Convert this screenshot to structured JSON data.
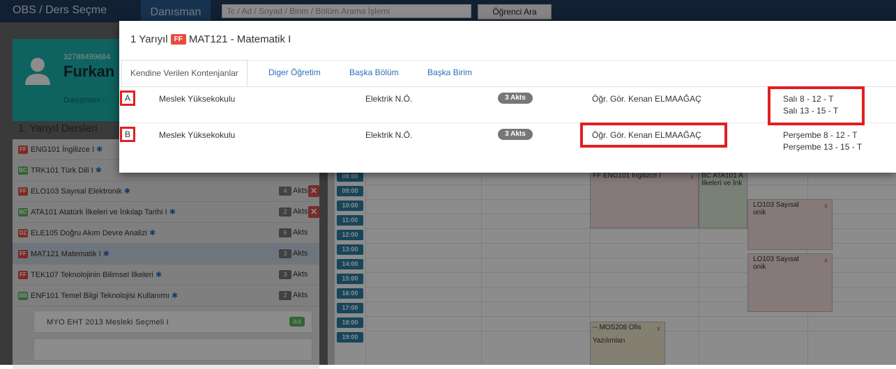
{
  "topbar": {
    "brand": "OBS / Ders Seçme",
    "danisman_tab": "Danısman",
    "search_placeholder": "Tc / Ad / Soyad / Birim / Bölüm  Arama İşlemi",
    "search_button": "Öğrenci Ara"
  },
  "profile": {
    "student_no": "32788499684",
    "name": "Furkan",
    "advisor_label": "Danışmanı :"
  },
  "courses": {
    "title": "1. Yarıyıl Dersleri",
    "items": [
      {
        "tag": "FF",
        "tag_color": "#e74c3c",
        "name": "ENG101 İngilizce I",
        "akts": "",
        "suffix": "",
        "deletable": false
      },
      {
        "tag": "BC",
        "tag_color": "#5cb85c",
        "name": "TRK101 Türk Dili I",
        "akts": "",
        "suffix": "Akts",
        "deletable": false
      },
      {
        "tag": "FF",
        "tag_color": "#e74c3c",
        "name": "ELO103 Sayısal Elektronik",
        "akts": "4",
        "suffix": "Akts",
        "deletable": true
      },
      {
        "tag": "BC",
        "tag_color": "#5cb85c",
        "name": "ATA101 Atatürk İlkeleri ve İnkılap Tarihi I",
        "akts": "2",
        "suffix": "Akts",
        "deletable": true
      },
      {
        "tag": "DZ",
        "tag_color": "#e74c3c",
        "name": "ELE105 Doğru Akım Devre Analizi",
        "akts": "6",
        "suffix": "Akts",
        "deletable": false
      },
      {
        "tag": "FF",
        "tag_color": "#e74c3c",
        "name": "MAT121 Matematik I",
        "akts": "3",
        "suffix": "Akts",
        "deletable": false
      },
      {
        "tag": "FF",
        "tag_color": "#e74c3c",
        "name": "TEK107 Teknolojinin Bilimsel İlkeleri",
        "akts": "3",
        "suffix": "Akts",
        "deletable": false
      },
      {
        "tag": "BB",
        "tag_color": "#5cb85c",
        "name": "ENF101 Temel Bilgi Teknolojisi Kullanımı",
        "akts": "2",
        "suffix": "Akts",
        "deletable": false
      }
    ],
    "electives": [
      {
        "name": "MYO EHT 2013 Mesleki Seçmeli I",
        "count": "4/4"
      }
    ]
  },
  "calendar": {
    "hours": [
      "08:00",
      "09:00",
      "10:00",
      "11:00",
      "12:00",
      "13:00",
      "14:00",
      "15:00",
      "16:00",
      "17:00",
      "18:00",
      "19:00"
    ],
    "events": {
      "eng": "FF ENG101 İngilizce I",
      "ata": "BC ATA101 A",
      "ata2": "İlkeleri ve İnk",
      "elo1a": "LO103 Sayısal",
      "elo1b": "onik",
      "elo2a": "LO103 Sayısal",
      "elo2b": "onik",
      "mosa": "-- MOS208 Ofis",
      "mosb": "Yazılımları",
      "close": "x"
    }
  },
  "modal": {
    "semester": "1 Yarıyıl",
    "badge": "FF",
    "course": "MAT121 - Matematik I",
    "tabs": [
      "Kendine Verilen Kontenjanlar",
      "Diger Öğretim",
      "Başka Bölüm",
      "Başka Birim"
    ],
    "rows": [
      {
        "section": "A",
        "school": "Meslek Yüksekokulu",
        "program": "Elektrik N.Ö.",
        "akts": "3 Akts",
        "teacher": "Öğr. Gör. Kenan ELMAAĞAÇ",
        "times": [
          "Salı 8 - 12 - T",
          "Salı 13 - 15 - T"
        ]
      },
      {
        "section": "B",
        "school": "Meslek Yüksekokulu",
        "program": "Elektrik N.Ö.",
        "akts": "3 Akts",
        "teacher": "Öğr. Gör. Kenan ELMAAĞAÇ",
        "times": [
          "Perşembe 8 - 12 - T",
          "Perşembe 13 - 15 - T"
        ]
      }
    ]
  }
}
